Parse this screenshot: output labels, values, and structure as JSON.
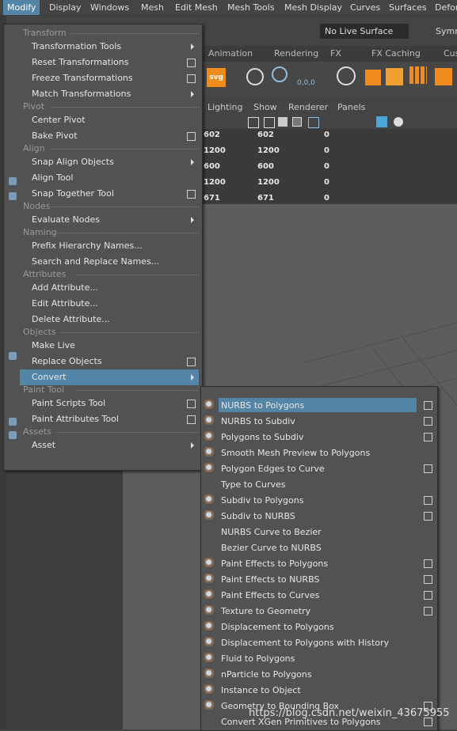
{
  "menubar": {
    "items": [
      "Modify",
      "Display",
      "Windows",
      "Mesh",
      "Edit Mesh",
      "Mesh Tools",
      "Mesh Display",
      "Curves",
      "Surfaces",
      "Defor"
    ],
    "active": "Modify"
  },
  "toolbar": {
    "live_surface": "No Live Surface",
    "symmetry": "Symm"
  },
  "shelf_tabs": [
    "Animation",
    "Rendering",
    "FX",
    "FX Caching",
    "Cus"
  ],
  "panel_menu": [
    "Lighting",
    "Show",
    "Renderer",
    "Panels"
  ],
  "stats_table": [
    [
      "602",
      "602",
      "0"
    ],
    [
      "1200",
      "1200",
      "0"
    ],
    [
      "600",
      "600",
      "0"
    ],
    [
      "1200",
      "1200",
      "0"
    ],
    [
      "671",
      "671",
      "0"
    ]
  ],
  "modify_menu": {
    "sections": [
      {
        "caption": "Transform",
        "items": [
          {
            "label": "Transformation Tools",
            "submenu": true,
            "option": false
          },
          {
            "label": "Reset Transformations",
            "submenu": false,
            "option": true
          },
          {
            "label": "Freeze Transformations",
            "submenu": false,
            "option": true
          },
          {
            "label": "Match Transformations",
            "submenu": true,
            "option": false
          }
        ]
      },
      {
        "caption": "Pivot",
        "items": [
          {
            "label": "Center Pivot",
            "submenu": false,
            "option": false
          },
          {
            "label": "Bake Pivot",
            "submenu": false,
            "option": true
          }
        ]
      },
      {
        "caption": "Align",
        "items": [
          {
            "label": "Snap Align Objects",
            "submenu": true,
            "option": false
          },
          {
            "label": "Align Tool",
            "submenu": false,
            "option": false
          },
          {
            "label": "Snap Together Tool",
            "submenu": false,
            "option": true
          }
        ]
      },
      {
        "caption": "Nodes",
        "items": [
          {
            "label": "Evaluate Nodes",
            "submenu": true,
            "option": false
          }
        ]
      },
      {
        "caption": "Naming",
        "items": [
          {
            "label": "Prefix Hierarchy Names...",
            "submenu": false,
            "option": false
          },
          {
            "label": "Search and Replace Names...",
            "submenu": false,
            "option": false
          }
        ]
      },
      {
        "caption": "Attributes",
        "items": [
          {
            "label": "Add Attribute...",
            "submenu": false,
            "option": false
          },
          {
            "label": "Edit Attribute...",
            "submenu": false,
            "option": false
          },
          {
            "label": "Delete Attribute...",
            "submenu": false,
            "option": false
          }
        ]
      },
      {
        "caption": "Objects",
        "items": [
          {
            "label": "Make Live",
            "submenu": false,
            "option": false
          },
          {
            "label": "Replace Objects",
            "submenu": false,
            "option": true
          },
          {
            "label": "Convert",
            "submenu": true,
            "option": false,
            "highlighted": true
          }
        ]
      },
      {
        "caption": "Paint Tool",
        "items": [
          {
            "label": "Paint Scripts Tool",
            "submenu": false,
            "option": true
          },
          {
            "label": "Paint Attributes Tool",
            "submenu": false,
            "option": true
          }
        ]
      },
      {
        "caption": "Assets",
        "items": [
          {
            "label": "Asset",
            "submenu": true,
            "option": false
          }
        ]
      }
    ]
  },
  "convert_menu": {
    "items": [
      {
        "label": "NURBS to Polygons",
        "option": true,
        "icon": "nurbs-to-polygons-icon",
        "highlighted": true
      },
      {
        "label": "NURBS to Subdiv",
        "option": true,
        "icon": "nurbs-to-subdiv-icon"
      },
      {
        "label": "Polygons to Subdiv",
        "option": true,
        "icon": "polygons-to-subdiv-icon"
      },
      {
        "label": "Smooth Mesh Preview to Polygons",
        "option": false,
        "icon": "smooth-mesh-icon"
      },
      {
        "label": "Polygon Edges to Curve",
        "option": true,
        "icon": "edges-to-curve-icon"
      },
      {
        "label": "Type to Curves",
        "option": false,
        "icon": ""
      },
      {
        "label": "Subdiv to Polygons",
        "option": true,
        "icon": "subdiv-to-polygons-icon"
      },
      {
        "label": "Subdiv to NURBS",
        "option": true,
        "icon": "subdiv-to-nurbs-icon"
      },
      {
        "label": "NURBS Curve to Bezier",
        "option": false,
        "icon": ""
      },
      {
        "label": "Bezier Curve to NURBS",
        "option": false,
        "icon": ""
      },
      {
        "label": "Paint Effects to Polygons",
        "option": true,
        "icon": "paint-effects-icon"
      },
      {
        "label": "Paint Effects to NURBS",
        "option": true,
        "icon": "paint-effects-icon"
      },
      {
        "label": "Paint Effects to Curves",
        "option": true,
        "icon": "paint-effects-icon"
      },
      {
        "label": "Texture to Geometry",
        "option": true,
        "icon": "texture-to-geometry-icon"
      },
      {
        "label": "Displacement to Polygons",
        "option": false,
        "icon": "displacement-icon"
      },
      {
        "label": "Displacement to Polygons with History",
        "option": false,
        "icon": "displacement-icon"
      },
      {
        "label": "Fluid to Polygons",
        "option": false,
        "icon": "fluid-icon"
      },
      {
        "label": "nParticle to Polygons",
        "option": false,
        "icon": "nparticle-icon"
      },
      {
        "label": "Instance to Object",
        "option": false,
        "icon": "instance-icon"
      },
      {
        "label": "Geometry to Bounding Box",
        "option": true,
        "icon": "bounding-box-icon"
      },
      {
        "label": "Convert XGen Primitives to Polygons",
        "option": true,
        "icon": ""
      }
    ]
  },
  "watermark": "https://blog.csdn.net/weixin_43675955",
  "colors": {
    "highlight": "#5285a6",
    "menu_bg": "#525252",
    "viewport": "#5d5d5d"
  }
}
